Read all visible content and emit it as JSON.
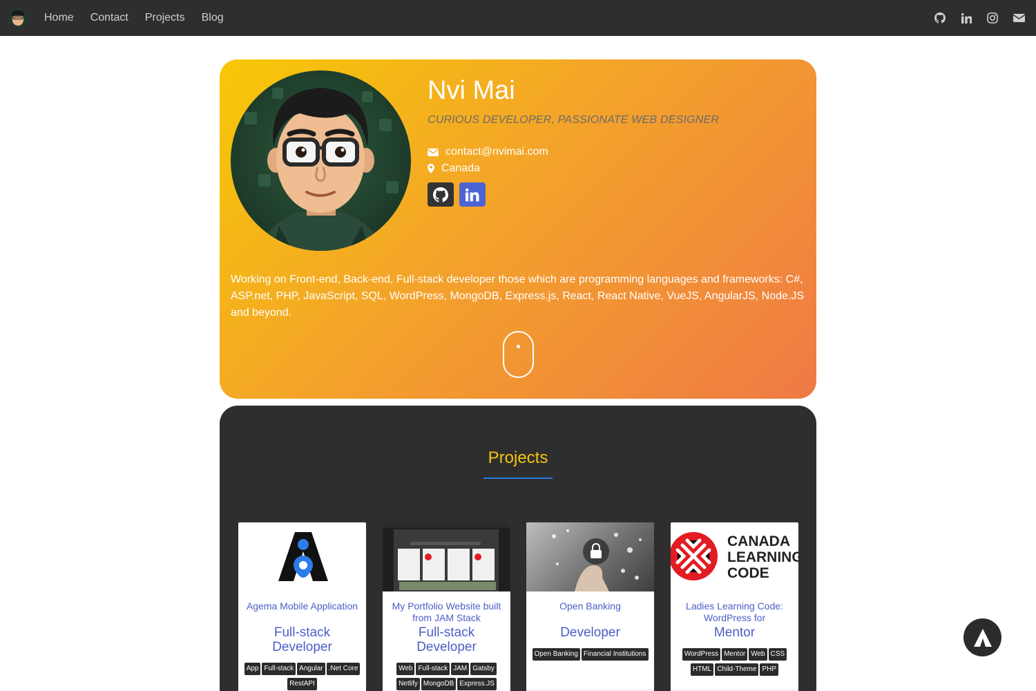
{
  "nav": {
    "links": [
      "Home",
      "Contact",
      "Projects",
      "Blog"
    ],
    "icons": [
      "github-icon",
      "linkedin-icon",
      "instagram-icon",
      "envelope-icon"
    ]
  },
  "profile": {
    "name": "Nvi Mai",
    "tagline": "CURIOUS DEVELOPER, PASSIONATE WEB DESIGNER",
    "email": "contact@nvimai.com",
    "location": "Canada",
    "description": "Working on Front-end, Back-end, Full-stack developer those which are programming languages and frameworks: C#, ASP.net, PHP, JavaScript, SQL, WordPress, MongoDB, Express.js, React, React Native, VueJS, AngularJS, Node.JS and beyond."
  },
  "projects": {
    "title": "Projects",
    "cards": [
      {
        "title": "Agema Mobile Application",
        "role": "Full-stack Developer",
        "tags": [
          "App",
          "Full-stack",
          "Angular",
          ".Net Core",
          "RestAPI"
        ]
      },
      {
        "title": "My Portfolio Website built from JAM Stack",
        "role": "Full-stack Developer",
        "tags": [
          "Web",
          "Full-stack",
          "JAM",
          "Gatsby",
          "Netlify",
          "MongoDB",
          "Express.JS"
        ]
      },
      {
        "title": "Open Banking",
        "role": "Developer",
        "tags": [
          "Open Banking",
          "Financial Institutions"
        ]
      },
      {
        "title": "Ladies Learning Code: WordPress for",
        "role": "Mentor",
        "tags": [
          "WordPress",
          "Mentor",
          "Web",
          "CSS",
          "HTML",
          "Child-Theme",
          "PHP"
        ],
        "logo_text": [
          "CANADA",
          "LEARNING",
          "CODE"
        ]
      }
    ]
  },
  "colors": {
    "navbar": "#2e2e2e",
    "hero_gradient_start": "#f7c806",
    "hero_gradient_end": "#ef7a45",
    "projects_title": "#f6c510",
    "accent_blue": "#4b5ec6",
    "underline": "#2a7ae2"
  }
}
